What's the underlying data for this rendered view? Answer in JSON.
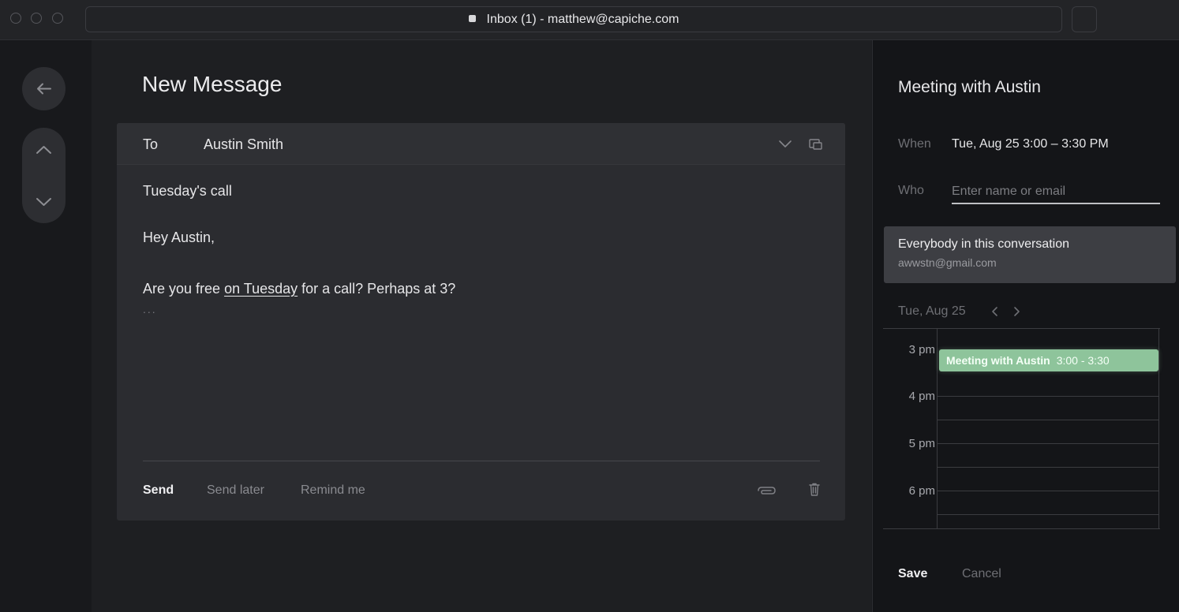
{
  "window": {
    "title": "Inbox (1) - matthew@capiche.com"
  },
  "compose": {
    "heading": "New Message",
    "to_label": "To",
    "to_value": "Austin Smith",
    "subject": "Tuesday's call",
    "greeting": "Hey Austin,",
    "body_before": "Are you free ",
    "body_link": "on Tuesday",
    "body_after": " for a call? Perhaps at 3?",
    "ellipsis": "...",
    "send_label": "Send",
    "send_later_label": "Send later",
    "remind_label": "Remind me"
  },
  "event_panel": {
    "title": "Meeting with Austin",
    "when_label": "When",
    "when_value": "Tue, Aug 25 3:00 – 3:30 PM",
    "who_label": "Who",
    "who_placeholder": "Enter name or email",
    "suggestion_name": "Everybody in this conversation",
    "suggestion_email": "awwstn@gmail.com",
    "calendar_date": "Tue, Aug 25",
    "hours": [
      "3 pm",
      "4 pm",
      "5 pm",
      "6 pm"
    ],
    "event_name": "Meeting with Austin",
    "event_time": "3:00 - 3:30",
    "event_color": "#8ec49b",
    "save_label": "Save",
    "cancel_label": "Cancel"
  },
  "icons": [
    "back-arrow-icon",
    "chevron-up-icon",
    "chevron-down-icon",
    "expand-recipients-icon",
    "popout-icon",
    "attachment-icon",
    "trash-icon",
    "chevron-left-icon",
    "chevron-right-icon"
  ]
}
